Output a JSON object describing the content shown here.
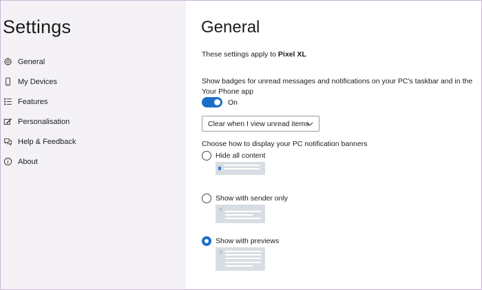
{
  "sidebar": {
    "title": "Settings",
    "items": [
      {
        "label": "General",
        "icon": "gear-icon"
      },
      {
        "label": "My Devices",
        "icon": "phone-icon"
      },
      {
        "label": "Features",
        "icon": "list-icon"
      },
      {
        "label": "Personalisation",
        "icon": "paint-icon"
      },
      {
        "label": "Help & Feedback",
        "icon": "chat-icon"
      },
      {
        "label": "About",
        "icon": "info-icon"
      }
    ]
  },
  "main": {
    "title": "General",
    "applies_prefix": "These settings apply to ",
    "device_name": "Pixel XL",
    "badges_description": "Show badges for unread messages and notifications on your PC's taskbar and in the Your Phone app",
    "badges_toggle": {
      "state": "On",
      "checked": true
    },
    "clear_dropdown": {
      "selected": "Clear when I view unread items"
    },
    "banners_heading": "Choose how to display your PC notification banners",
    "banner_options": [
      {
        "label": "Hide all content",
        "checked": false
      },
      {
        "label": "Show with sender only",
        "checked": false
      },
      {
        "label": "Show with previews",
        "checked": true
      }
    ]
  },
  "colors": {
    "accent": "#1a6fc9",
    "sidebar_bg": "#f4f2f6",
    "preview_bg": "#d8dde3"
  }
}
